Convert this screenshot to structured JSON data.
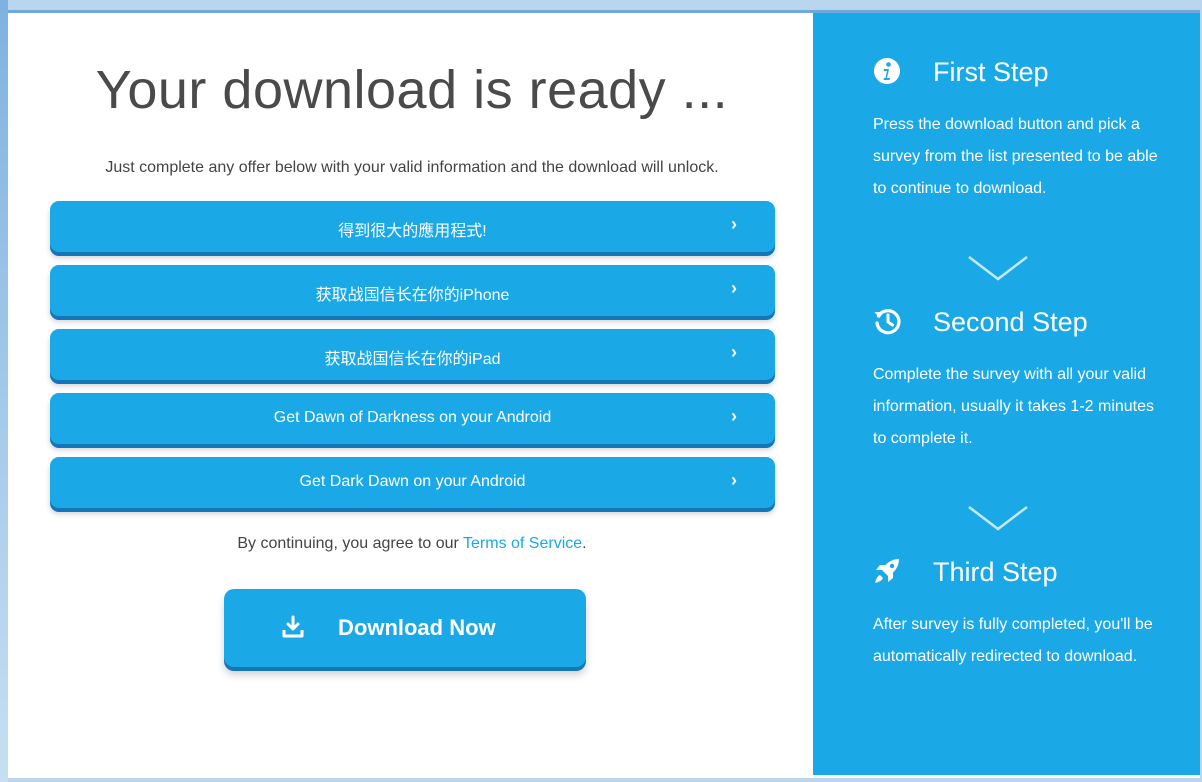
{
  "main": {
    "title": "Your download is ready ...",
    "subtitle": "Just complete any offer below with your valid information and the download will unlock.",
    "offers": [
      {
        "label": "得到很大的應用程式!",
        "chevron": "›"
      },
      {
        "label": "获取战国信长在你的iPhone",
        "chevron": "›"
      },
      {
        "label": "获取战国信长在你的iPad",
        "chevron": "›"
      },
      {
        "label": "Get Dawn of Darkness on your Android",
        "chevron": "›"
      },
      {
        "label": "Get Dark Dawn on your Android",
        "chevron": "›"
      }
    ],
    "terms_prefix": "By continuing, you agree to our ",
    "terms_link": "Terms of Service",
    "terms_suffix": ".",
    "download_button": "Download Now"
  },
  "sidebar": {
    "steps": [
      {
        "icon": "info-icon",
        "title": "First Step",
        "text": "Press the download button and pick a survey from the list presented to be able to continue to download."
      },
      {
        "icon": "history-icon",
        "title": "Second Step",
        "text": "Complete the survey with all your valid information, usually it takes 1-2 minutes to complete it."
      },
      {
        "icon": "rocket-icon",
        "title": "Third Step",
        "text": "After survey is fully completed, you'll be automatically redirected to download."
      }
    ]
  },
  "colors": {
    "accent": "#1aa9e6",
    "accent_shadow": "#1575b8",
    "text": "#444444",
    "title": "#4a4a4a"
  }
}
